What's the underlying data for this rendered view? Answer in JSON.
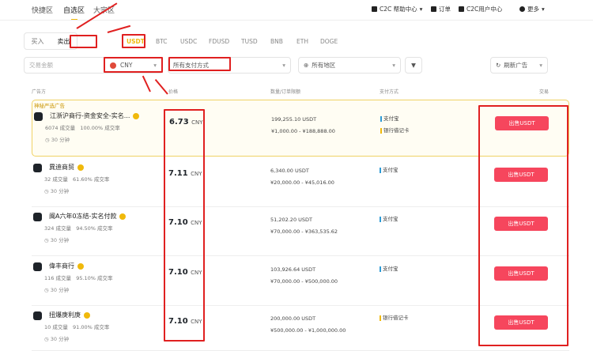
{
  "nav": {
    "tabs": [
      "快捷区",
      "自选区",
      "大宗区"
    ],
    "active": 1,
    "right": [
      {
        "label": "C2C 帮助中心",
        "icon": "help-icon"
      },
      {
        "label": "订单",
        "icon": "order-icon"
      },
      {
        "label": "C2C用户中心",
        "icon": "user-center-icon"
      },
      {
        "label": "更多",
        "icon": "more-icon"
      }
    ]
  },
  "side": {
    "buy": "买入",
    "sell": "卖出",
    "selected": "sell"
  },
  "coins": [
    "USDT",
    "BTC",
    "USDC",
    "FDUSD",
    "TUSD",
    "BNB",
    "ETH",
    "DOGE"
  ],
  "filters": {
    "amount_placeholder": "交易金额",
    "currency": "CNY",
    "payment": "所有支付方式",
    "region": "所有地区",
    "refresh": "刷新广告"
  },
  "headers": [
    "广告方",
    "价格",
    "数量/订单限额",
    "支付方式",
    "交易"
  ],
  "featured_label": "神秘严选广告",
  "accent": "#f0b90b",
  "sell_color": "#f6465d",
  "ads": [
    {
      "name": "江浙沪商行-资金安全-实名...",
      "orders": "6074 成交量",
      "rate": "100.00% 成交率",
      "time": "30 分钟",
      "price": "6.73",
      "unit": "CNY",
      "qty": "199,255.10 USDT",
      "limit": "¥1,000.00 - ¥188,888.00",
      "pay": [
        "支付宝",
        "银行借记卡"
      ],
      "action": "出售USDT"
    },
    {
      "name": "異迪商贸",
      "orders": "32 成交量",
      "rate": "61.60% 成交率",
      "time": "30 分钟",
      "price": "7.11",
      "unit": "CNY",
      "qty": "6,340.00 USDT",
      "limit": "¥20,000.00 - ¥45,016.00",
      "pay": [
        "支付宝"
      ],
      "action": "出售USDT"
    },
    {
      "name": "闽A六年0冻结-实名付款",
      "orders": "324 成交量",
      "rate": "94.50% 成交率",
      "time": "30 分钟",
      "price": "7.10",
      "unit": "CNY",
      "qty": "51,202.20 USDT",
      "limit": "¥70,000.00 - ¥363,535.62",
      "pay": [
        "支付宝"
      ],
      "action": "出售USDT"
    },
    {
      "name": "偉丰商行",
      "orders": "116 成交量",
      "rate": "95.10% 成交率",
      "time": "30 分钟",
      "price": "7.10",
      "unit": "CNY",
      "qty": "103,926.64 USDT",
      "limit": "¥70,000.00 - ¥500,000.00",
      "pay": [
        "支付宝"
      ],
      "action": "出售USDT"
    },
    {
      "name": "扭爆庚利庚",
      "orders": "10 成交量",
      "rate": "91.00% 成交率",
      "time": "30 分钟",
      "price": "7.10",
      "unit": "CNY",
      "qty": "200,000.00 USDT",
      "limit": "¥500,000.00 - ¥1,000,000.00",
      "pay": [
        "银行借记卡"
      ],
      "action": "出售USDT"
    }
  ]
}
